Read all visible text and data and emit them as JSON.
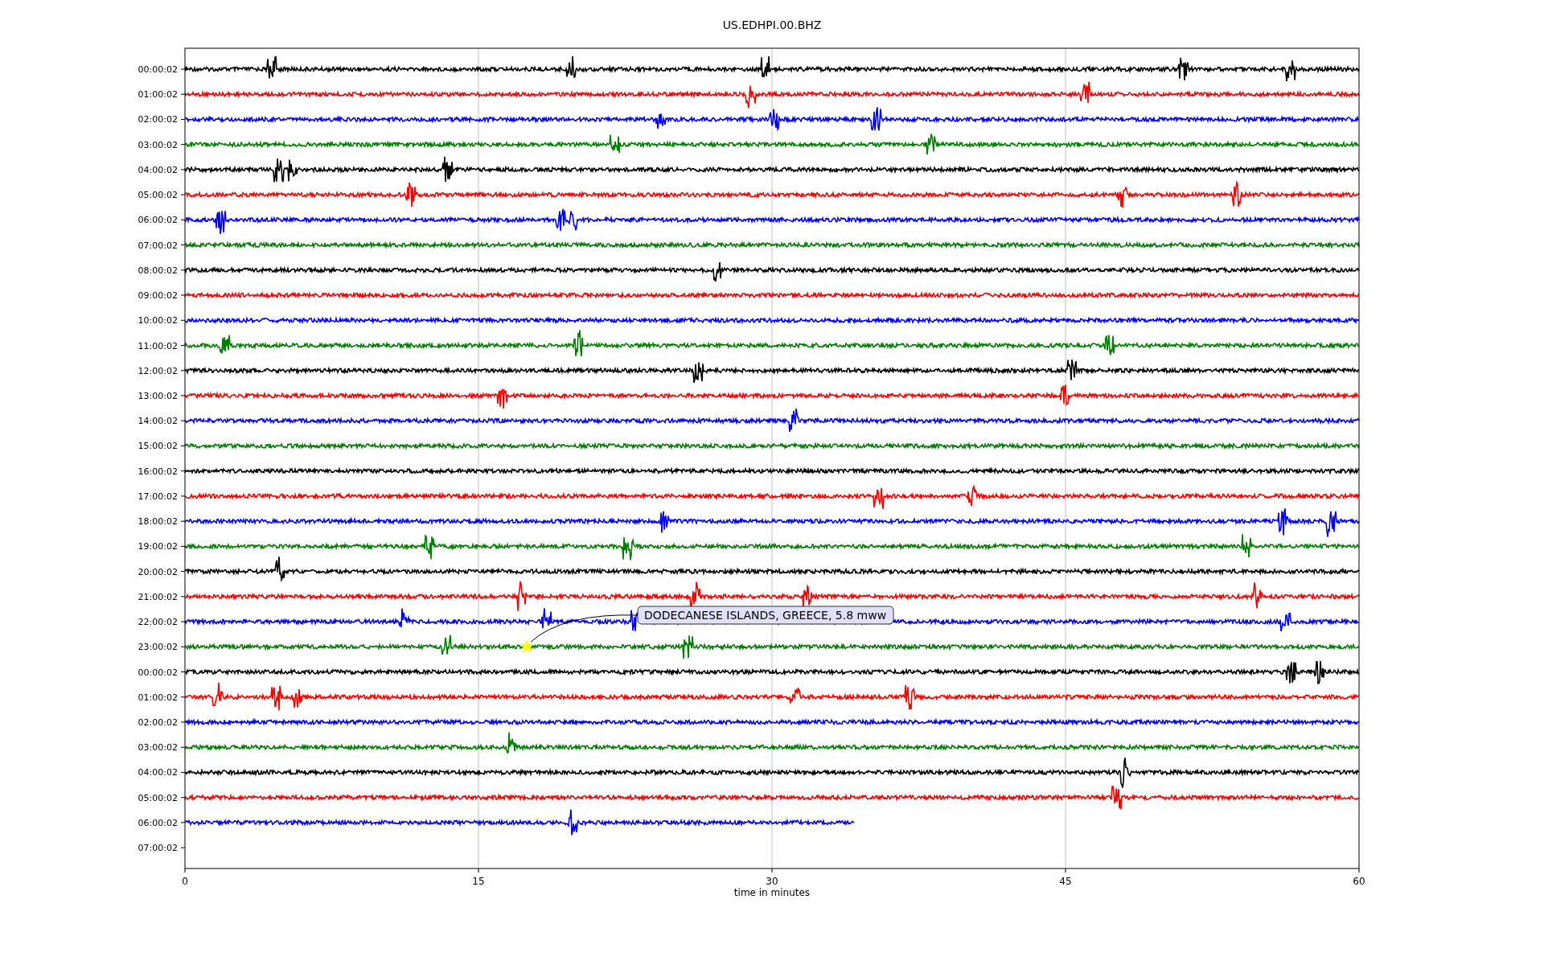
{
  "title": "US.EDHPI.00.BHZ",
  "xlabel": "time in minutes",
  "xticks": [
    "0",
    "15",
    "30",
    "45",
    "60"
  ],
  "rows": [
    {
      "label": "00:00:02",
      "color": "#000000",
      "level": 1
    },
    {
      "label": "01:00:02",
      "color": "#ff0000",
      "level": 1
    },
    {
      "label": "02:00:02",
      "color": "#0000ff",
      "level": 1
    },
    {
      "label": "03:00:02",
      "color": "#008000",
      "level": 1
    },
    {
      "label": "04:00:02",
      "color": "#000000",
      "level": 1
    },
    {
      "label": "05:00:02",
      "color": "#ff0000",
      "level": 1
    },
    {
      "label": "06:00:02",
      "color": "#0000ff",
      "level": 1
    },
    {
      "label": "07:00:02",
      "color": "#008000",
      "level": 1
    },
    {
      "label": "08:00:02",
      "color": "#000000",
      "level": 1
    },
    {
      "label": "09:00:02",
      "color": "#ff0000",
      "level": 1
    },
    {
      "label": "10:00:02",
      "color": "#0000ff",
      "level": 1
    },
    {
      "label": "11:00:02",
      "color": "#008000",
      "level": 1
    },
    {
      "label": "12:00:02",
      "color": "#000000",
      "level": 1
    },
    {
      "label": "13:00:02",
      "color": "#ff0000",
      "level": 1
    },
    {
      "label": "14:00:02",
      "color": "#0000ff",
      "level": 1
    },
    {
      "label": "15:00:02",
      "color": "#008000",
      "level": 1
    },
    {
      "label": "16:00:02",
      "color": "#000000",
      "level": 1
    },
    {
      "label": "17:00:02",
      "color": "#ff0000",
      "level": 1
    },
    {
      "label": "18:00:02",
      "color": "#0000ff",
      "level": 1
    },
    {
      "label": "19:00:02",
      "color": "#008000",
      "level": 1
    },
    {
      "label": "20:00:02",
      "color": "#000000",
      "level": 1
    },
    {
      "label": "21:00:02",
      "color": "#ff0000",
      "level": 1
    },
    {
      "label": "22:00:02",
      "color": "#0000ff",
      "level": 1
    },
    {
      "label": "23:00:02",
      "color": "#008000",
      "level": 1
    },
    {
      "label": "00:00:02",
      "color": "#000000",
      "level": 1
    },
    {
      "label": "01:00:02",
      "color": "#ff0000",
      "level": 1
    },
    {
      "label": "02:00:02",
      "color": "#0000ff",
      "level": 1
    },
    {
      "label": "03:00:02",
      "color": "#008000",
      "level": 1
    },
    {
      "label": "04:00:02",
      "color": "#000000",
      "level": 1
    },
    {
      "label": "05:00:02",
      "color": "#ff0000",
      "level": 1
    },
    {
      "label": "06:00:02",
      "color": "#0000ff",
      "level": 0.57
    },
    {
      "label": "07:00:02"
    }
  ],
  "event": {
    "label": "DODECANESE ISLANDS, GREECE, 5.8 mww"
  }
}
